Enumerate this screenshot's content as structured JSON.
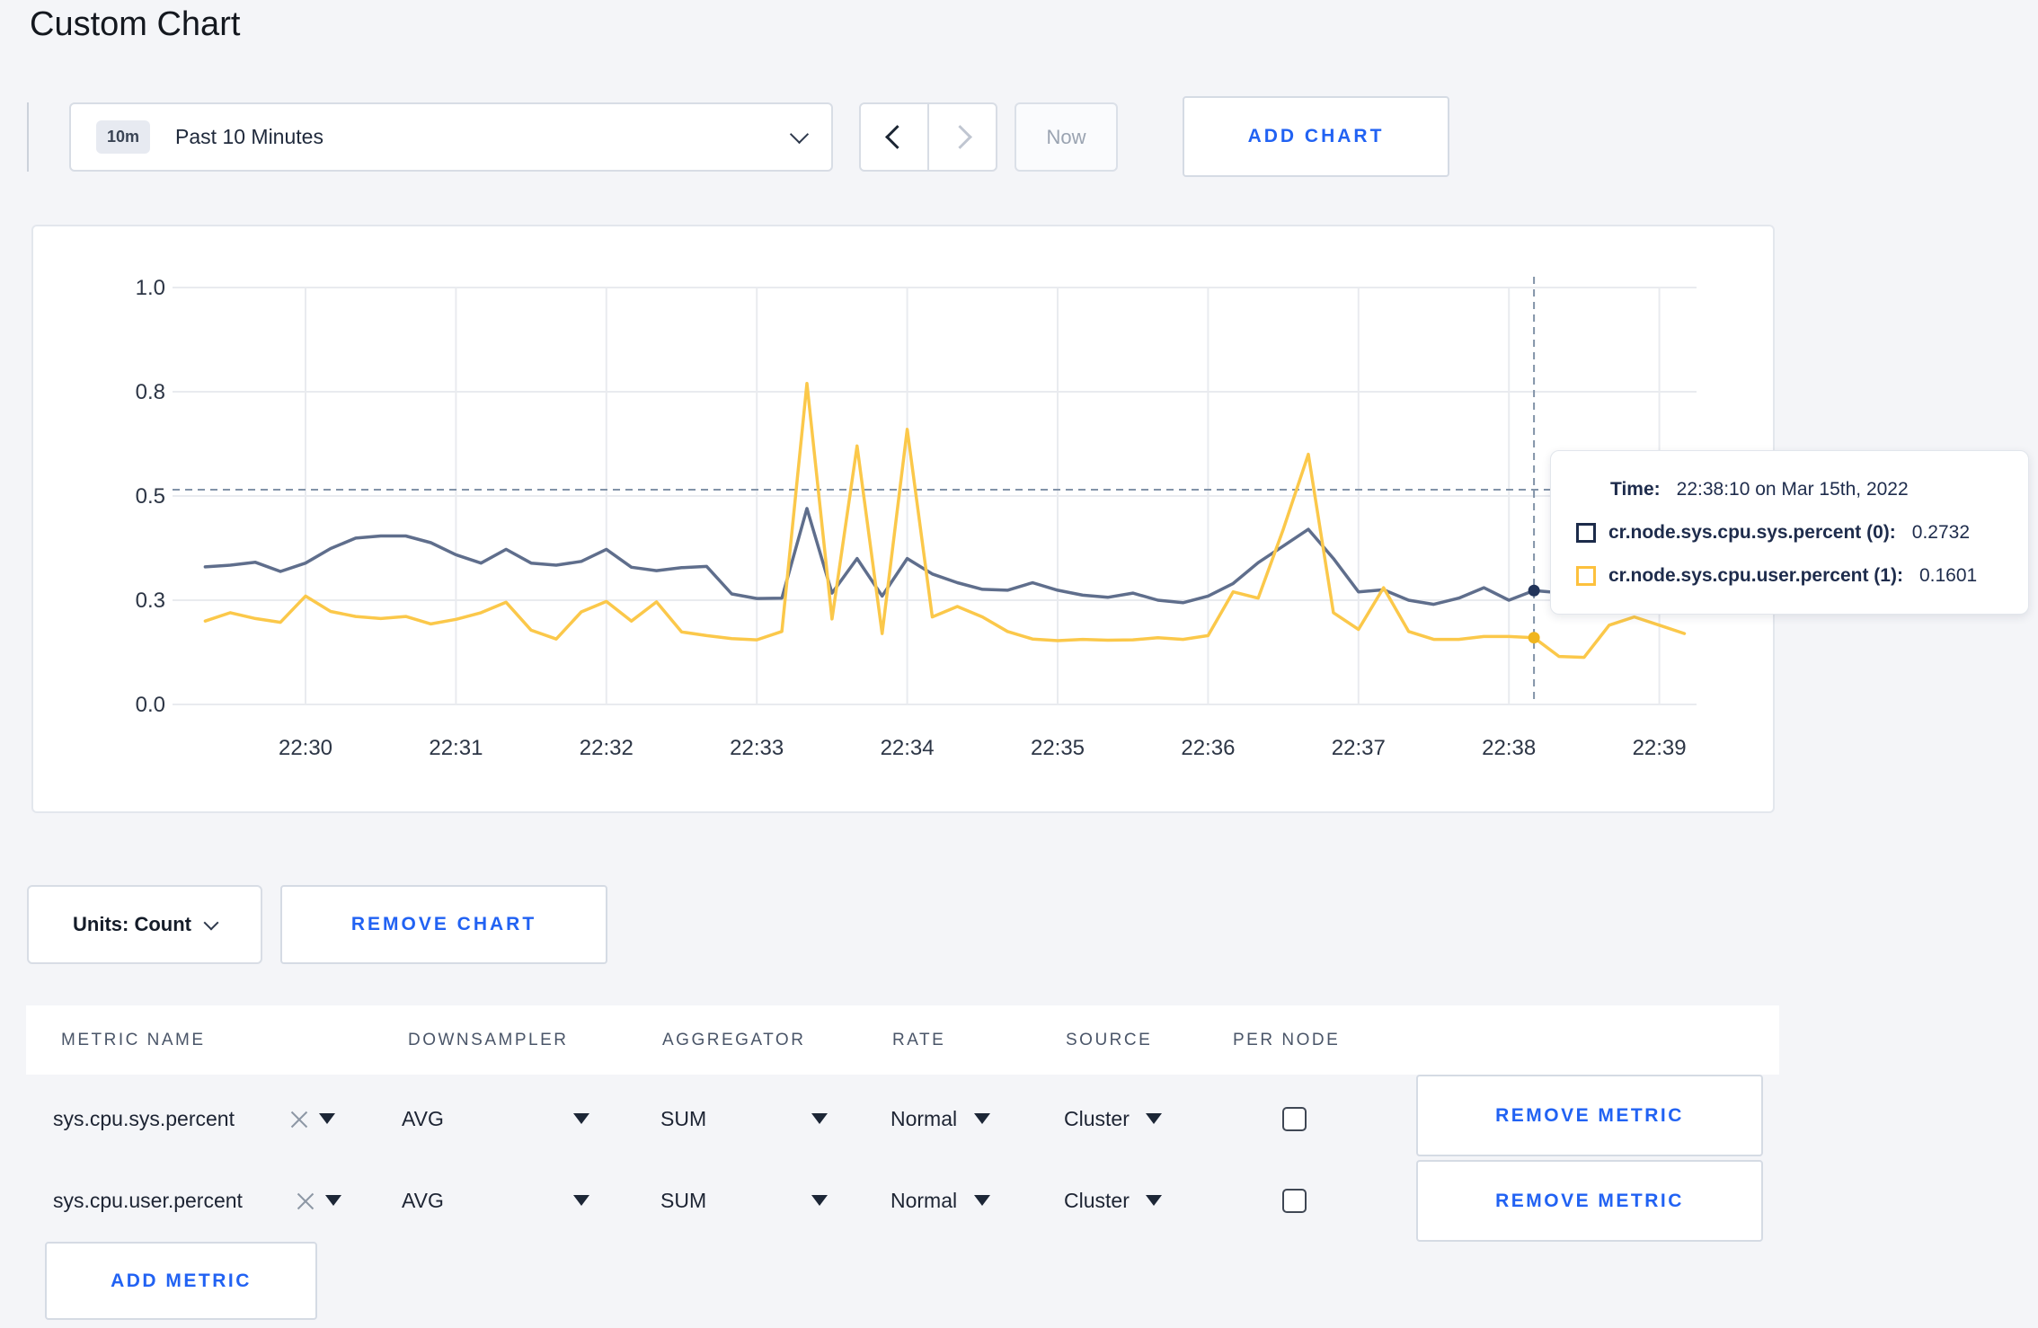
{
  "page": {
    "title": "Custom Chart",
    "background": "#f4f5f8",
    "accent_blue": "#2162f3"
  },
  "toolbar": {
    "time_badge": "10m",
    "time_label": "Past 10 Minutes",
    "now_label": "Now",
    "add_chart_label": "ADD CHART"
  },
  "chart_footer": {
    "units_label": "Units: Count",
    "remove_chart_label": "REMOVE CHART"
  },
  "tooltip": {
    "time_label": "Time:",
    "time_value": "22:38:10 on Mar 15th, 2022",
    "rows": [
      {
        "label": "cr.node.sys.cpu.sys.percent (0):",
        "value": "0.2732",
        "swatch": "#1c2b4a"
      },
      {
        "label": "cr.node.sys.cpu.user.percent (1):",
        "value": "0.1601",
        "swatch": "#fdc13d"
      }
    ]
  },
  "chart_data": {
    "type": "line",
    "title": "",
    "xlabel": "",
    "ylabel": "",
    "grid": true,
    "legend_position": "tooltip",
    "style": {
      "grid_color": "#e9ebef",
      "axis_text_color": "#2c3545",
      "crosshair_color": "#8293a8"
    },
    "x_axis": {
      "tick_labels": [
        "22:30",
        "22:31",
        "22:32",
        "22:33",
        "22:34",
        "22:35",
        "22:36",
        "22:37",
        "22:38",
        "22:39"
      ],
      "samples_start": "22:29:20",
      "samples_interval_sec": 10
    },
    "y_axis": {
      "range": [
        0,
        1
      ],
      "ticks": [
        {
          "value": 0.0,
          "label": "0.0"
        },
        {
          "value": 0.25,
          "label": "0.3"
        },
        {
          "value": 0.5,
          "label": "0.5"
        },
        {
          "value": 0.75,
          "label": "0.8"
        },
        {
          "value": 1.0,
          "label": "1.0"
        }
      ]
    },
    "crosshair": {
      "sample_index": 53,
      "horizontal_value": 0.515,
      "time": "22:38:10"
    },
    "series": [
      {
        "name": "cr.node.sys.cpu.sys.percent (0)",
        "color": "#5f6e8c",
        "dot_color": "#22345a",
        "values": [
          0.33,
          0.334,
          0.341,
          0.319,
          0.339,
          0.374,
          0.399,
          0.404,
          0.404,
          0.388,
          0.359,
          0.339,
          0.372,
          0.339,
          0.334,
          0.343,
          0.372,
          0.329,
          0.321,
          0.328,
          0.331,
          0.265,
          0.254,
          0.255,
          0.47,
          0.267,
          0.35,
          0.26,
          0.35,
          0.313,
          0.292,
          0.276,
          0.274,
          0.292,
          0.274,
          0.262,
          0.257,
          0.267,
          0.25,
          0.244,
          0.26,
          0.29,
          0.34,
          0.38,
          0.42,
          0.35,
          0.27,
          0.275,
          0.25,
          0.24,
          0.255,
          0.28,
          0.25,
          0.2732,
          0.268,
          0.28,
          0.295,
          0.305,
          0.3,
          0.305
        ]
      },
      {
        "name": "cr.node.sys.cpu.user.percent (1)",
        "color": "#fbc84a",
        "dot_color": "#f0b51e",
        "values": [
          0.2,
          0.22,
          0.206,
          0.197,
          0.26,
          0.223,
          0.211,
          0.206,
          0.211,
          0.193,
          0.204,
          0.22,
          0.245,
          0.178,
          0.157,
          0.222,
          0.247,
          0.2,
          0.246,
          0.174,
          0.165,
          0.158,
          0.155,
          0.175,
          0.77,
          0.205,
          0.62,
          0.17,
          0.66,
          0.21,
          0.235,
          0.21,
          0.175,
          0.157,
          0.153,
          0.156,
          0.154,
          0.155,
          0.16,
          0.156,
          0.165,
          0.27,
          0.255,
          0.42,
          0.6,
          0.22,
          0.18,
          0.28,
          0.175,
          0.156,
          0.156,
          0.163,
          0.163,
          0.1601,
          0.115,
          0.113,
          0.19,
          0.21,
          0.19,
          0.17
        ]
      }
    ]
  },
  "metrics_table": {
    "headers": [
      "METRIC NAME",
      "DOWNSAMPLER",
      "AGGREGATOR",
      "RATE",
      "SOURCE",
      "PER NODE"
    ],
    "rows": [
      {
        "name": "sys.cpu.sys.percent",
        "downsampler": "AVG",
        "aggregator": "SUM",
        "rate": "Normal",
        "source": "Cluster",
        "per_node_checked": false,
        "remove_label": "REMOVE METRIC"
      },
      {
        "name": "sys.cpu.user.percent",
        "downsampler": "AVG",
        "aggregator": "SUM",
        "rate": "Normal",
        "source": "Cluster",
        "per_node_checked": false,
        "remove_label": "REMOVE METRIC"
      }
    ],
    "add_metric_label": "ADD METRIC"
  }
}
